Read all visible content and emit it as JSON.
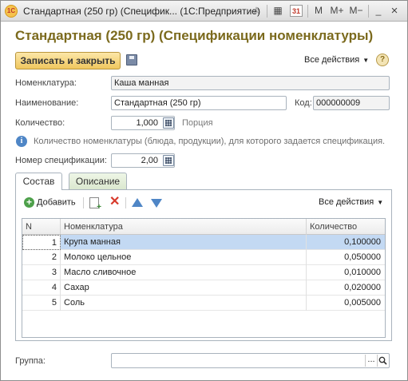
{
  "window": {
    "title": "Стандартная (250 гр) (Специфик... (1С:Предприятие)",
    "logo": "1С",
    "toolbar": {
      "star": "☆",
      "calc": "▦",
      "calendar": "31",
      "m": "M",
      "mplus": "M+",
      "mminus": "M−",
      "minimize": "_",
      "close": "×"
    }
  },
  "form": {
    "title": "Стандартная (250 гр) (Спецификации номенклатуры)",
    "save_close_label": "Записать и закрыть",
    "all_actions_label": "Все действия",
    "help": "?"
  },
  "fields": {
    "nomenclature_label": "Номенклатура:",
    "nomenclature_value": "Каша манная",
    "name_label": "Наименование:",
    "name_value": "Стандартная (250 гр)",
    "code_label": "Код:",
    "code_value": "000000009",
    "quantity_label": "Количество:",
    "quantity_value": "1,000",
    "quantity_unit": "Порция",
    "info_text": "Количество номенклатуры (блюда, продукции), для которого задается спецификация.",
    "spec_number_label": "Номер спецификации:",
    "spec_number_value": "2,00",
    "group_label": "Группа:",
    "group_value": ""
  },
  "tabs": [
    {
      "label": "Состав",
      "active": true
    },
    {
      "label": "Описание",
      "active": false
    }
  ],
  "composition": {
    "add_label": "Добавить",
    "all_actions_label": "Все действия",
    "columns": {
      "n": "N",
      "name": "Номенклатура",
      "qty": "Количество"
    },
    "rows": [
      {
        "n": "1",
        "name": "Крупа манная",
        "qty": "0,100000"
      },
      {
        "n": "2",
        "name": "Молоко цельное",
        "qty": "0,050000"
      },
      {
        "n": "3",
        "name": "Масло сливочное",
        "qty": "0,010000"
      },
      {
        "n": "4",
        "name": "Сахар",
        "qty": "0,020000"
      },
      {
        "n": "5",
        "name": "Соль",
        "qty": "0,005000"
      }
    ]
  },
  "colors": {
    "title": "#7b6a1d",
    "primary_button": "#f0c75e",
    "selected_row": "#c3d9f3",
    "accent_blue": "#4f86c6"
  }
}
